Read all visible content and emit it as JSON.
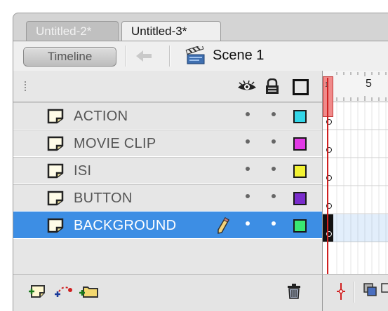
{
  "tabs": [
    {
      "label": "Untitled-2*",
      "active": false
    },
    {
      "label": "Untitled-3*",
      "active": true
    }
  ],
  "toolbar": {
    "timeline_label": "Timeline",
    "scene_label": "Scene 1"
  },
  "header_icons": [
    "eye-icon",
    "lock-icon",
    "outline-icon"
  ],
  "layers": [
    {
      "name": "ACTION",
      "color": "#33d6e8",
      "selected": false
    },
    {
      "name": "MOVIE CLIP",
      "color": "#e23ae6",
      "selected": false
    },
    {
      "name": "ISI",
      "color": "#f2f233",
      "selected": false
    },
    {
      "name": "BUTTON",
      "color": "#7a2ccc",
      "selected": false
    },
    {
      "name": "BACKGROUND",
      "color": "#39e872",
      "selected": true
    }
  ],
  "frames": {
    "current_frame": "1",
    "ruler_label": "5"
  },
  "footer_icons": [
    "new-layer-icon",
    "motion-guide-icon",
    "new-folder-icon",
    "trash-icon"
  ],
  "colors": {
    "selection": "#3d8ee4",
    "playhead": "#d02020"
  }
}
